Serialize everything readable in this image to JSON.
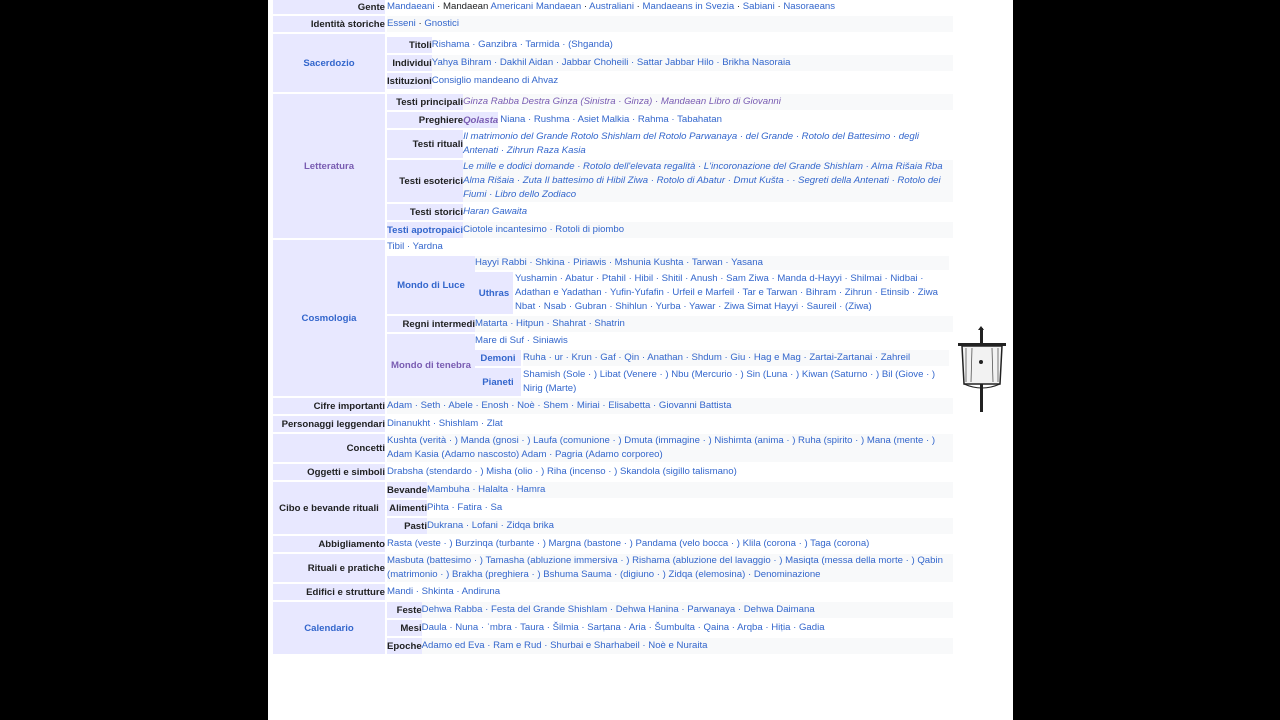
{
  "rows": [
    {
      "group": "Gente",
      "items": [
        [
          "Mandaeani",
          1
        ],
        [
          "Mandaean",
          0
        ],
        [
          "Americani Mandaean",
          1
        ],
        [
          "Australiani",
          1
        ],
        [
          "Mandaeans in Svezia",
          1
        ],
        [
          "Sabiani",
          1
        ],
        [
          "Nasoraeans",
          1
        ]
      ]
    },
    {
      "group": "Identità storiche",
      "items": [
        [
          "Esseni",
          1
        ],
        [
          "Gnostici",
          1
        ]
      ]
    },
    {
      "group": "Sacerdozio",
      "sub": [
        {
          "label": "Titoli",
          "text": "Rishama · Ganzibra · Tarmida · (Shganda)"
        },
        {
          "label": "Individui",
          "text": "Yahya Bihram · Dakhil Aidan · Jabbar Choheili · Sattar Jabbar Hilo · Brikha Nasoraia"
        },
        {
          "label": "Istituzioni",
          "text": "Consiglio mandeano di Ahvaz"
        }
      ]
    },
    {
      "group": "Letteratura",
      "sub": [
        {
          "label": "Testi principali",
          "text": "Ginza Rabba Destra Ginza (Sinistra · Ginza) · Mandaean Libro di Giovanni"
        },
        {
          "label": "Preghiere",
          "inner_label": "Qolasta",
          "text": "Niana · Rushma · Asiet Malkia · Rahma · Tabahatan"
        },
        {
          "label": "Testi rituali",
          "text": "Il matrimonio del Grande Rotolo Shishlam del Rotolo Parwanaya · del Grande · Rotolo del Battesimo · degli Antenati · Zihrun Raza Kasia"
        },
        {
          "label": "Testi esoterici",
          "text": "Le mille e dodici domande · Rotolo dell'elevata regalità · L'incoronazione del Grande Shishlam · Alma Rišaia Rba Alma Rišaia · Zuta Il battesimo di Hibil Ziwa · Rotolo di Abatur · Dmut Kušta · · Segreti della Antenati · Rotolo dei Fiumi · Libro dello Zodiaco"
        },
        {
          "label": "Testi storici",
          "text": "Haran Gawaita"
        },
        {
          "label": "Testi apotropaici",
          "text": "Ciotole incantesimo · Rotoli di piombo"
        }
      ]
    },
    {
      "group": "Cosmologia",
      "top_text": "Tibil · Yardna",
      "mondo_luce": {
        "label": "Mondo di Luce",
        "line1": "Hayyi Rabbi · Shkina · Piriawis · Mshunia Kushta · Tarwan · Yasana",
        "uthras_label": "Uthras",
        "uthras": "Yushamin · Abatur · Ptahil · Hibil · Shitil · Anush · Sam Ziwa · Manda d-Hayyi · Shilmai · Nidbai · Adathan e Yadathan · Yufin-Yufafin · Urfeil e Marfeil · Tar e Tarwan · Bihram · Zihrun · Etinsib · Ziwa Nbat · Nsab · Gubran · Shihlun · Yurba · Yawar · Ziwa Simat Hayyi · Saureil · (Ziwa)"
      },
      "regni": {
        "label": "Regni intermedi",
        "text": "Matarta · Hitpun · Shahrat · Shatrin"
      },
      "mondo_tenebra": {
        "label": "Mondo di tenebra",
        "line1": "Mare di Suf · Siniawis",
        "demoni_label": "Demoni",
        "demoni": "Ruha · ur · Krun · Gaf · Qin · Anathan · Shdum · Giu · Hag e Mag · Zartai-Zartanai · Zahreil",
        "pianeti_label": "Pianeti",
        "pianeti": "Shamish (Sole · ) Libat (Venere · ) Nbu (Mercurio · ) Sin (Luna · ) Kiwan (Saturno · ) Bil (Giove · ) Nirig (Marte)"
      }
    },
    {
      "group": "Cifre importanti",
      "text": "Adam · Seth · Abele · Enosh · Noè · Shem · Miriai · Elisabetta · Giovanni Battista"
    },
    {
      "group": "Personaggi leggendari",
      "text": "Dinanukht · Shishlam · Zlat"
    },
    {
      "group": "Concetti",
      "text": "Kushta (verità · ) Manda (gnosi · ) Laufa (comunione · ) Dmuta (immagine · ) Nishimta (anima · ) Ruha (spirito · ) Mana (mente · ) Adam Kasia (Adamo nascosto) Adam · Pagria (Adamo corporeo)"
    },
    {
      "group": "Oggetti e simboli",
      "text": "Drabsha (stendardo · ) Misha (olio · ) Riha (incenso · ) Skandola (sigillo talismano)"
    },
    {
      "group": "Cibo e bevande rituali",
      "sub": [
        {
          "label": "Bevande",
          "text": "Mambuha · Halalta · Hamra"
        },
        {
          "label": "Alimenti",
          "text": "Pihta · Fatira · Sa"
        },
        {
          "label": "Pasti",
          "text": "Dukrana · Lofani · Zidqa brika"
        }
      ]
    },
    {
      "group": "Abbigliamento",
      "text": "Rasta (veste · ) Burzinqa (turbante · ) Margna (bastone · ) Pandama (velo bocca · ) Klila (corona · ) Taga (corona)"
    },
    {
      "group": "Rituali e pratiche",
      "text": "Masbuta (battesimo · ) Tamasha (abluzione immersiva · ) Rishama (abluzione del lavaggio · ) Masiqta (messa della morte · ) Qabin (matrimonio · ) Brakha (preghiera · ) Bshuma Sauma · (digiuno · ) Zidqa (elemosina) · Denominazione"
    },
    {
      "group": "Edifici e strutture",
      "text": "Mandi · Shkinta · Andiruna"
    },
    {
      "group": "Calendario",
      "sub": [
        {
          "label": "Feste",
          "text": "Dehwa Rabba · Festa del Grande Shishlam · Dehwa Hanina · Parwanaya · Dehwa Daimana"
        },
        {
          "label": "Mesi",
          "text": "Daula · Nuna · ʿmbra · Taura · Šilmia · Sarṭana · Aria · Šumbulta · Qaina · Arqba · Hiṭia · Gadia"
        },
        {
          "label": "Epoche",
          "text": "Adamo ed Eva · Ram e Rud · Shurbai e Sharhabeil · Noè e Nuraita"
        }
      ]
    }
  ],
  "image": {
    "icon": "drabsha-icon"
  }
}
